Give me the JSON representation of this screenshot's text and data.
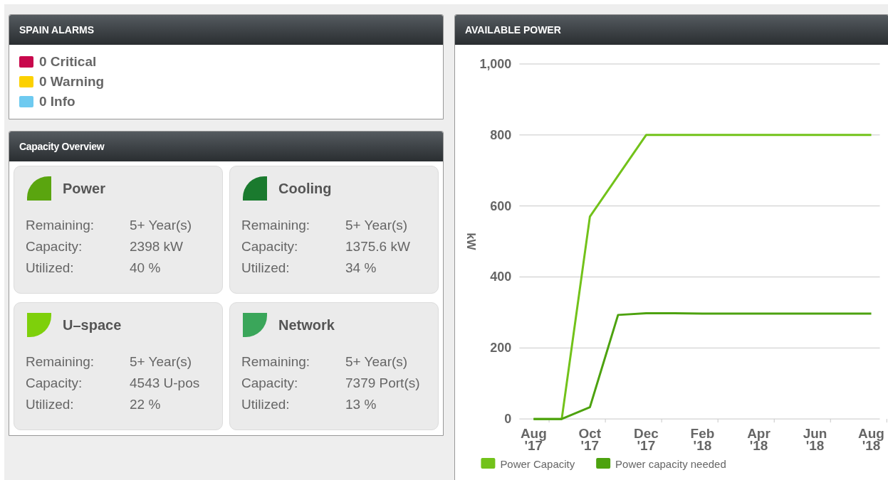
{
  "alarms": {
    "title": "SPAIN ALARMS",
    "items": [
      {
        "label": "0 Critical",
        "color": "#c8084c"
      },
      {
        "label": "0 Warning",
        "color": "#fcd100"
      },
      {
        "label": "0 Info",
        "color": "#6ecaf0"
      }
    ]
  },
  "capacity": {
    "title": "Capacity Overview",
    "cards": [
      {
        "name": "Power",
        "color": "#5aa50f",
        "rows": [
          {
            "label": "Remaining:",
            "value": "5+ Year(s)"
          },
          {
            "label": "Capacity:",
            "value": "2398 kW"
          },
          {
            "label": "Utilized:",
            "value": "40 %"
          }
        ]
      },
      {
        "name": "Cooling",
        "color": "#1a7a2e",
        "rows": [
          {
            "label": "Remaining:",
            "value": "5+ Year(s)"
          },
          {
            "label": "Capacity:",
            "value": "1375.6 kW"
          },
          {
            "label": "Utilized:",
            "value": "34 %"
          }
        ]
      },
      {
        "name": "U–space",
        "color": "#7ed00b",
        "rows": [
          {
            "label": "Remaining:",
            "value": "5+ Year(s)"
          },
          {
            "label": "Capacity:",
            "value": "4543 U-pos"
          },
          {
            "label": "Utilized:",
            "value": "22 %"
          }
        ]
      },
      {
        "name": "Network",
        "color": "#3aa65a",
        "rows": [
          {
            "label": "Remaining:",
            "value": "5+ Year(s)"
          },
          {
            "label": "Capacity:",
            "value": "7379 Port(s)"
          },
          {
            "label": "Utilized:",
            "value": "13 %"
          }
        ]
      }
    ]
  },
  "power": {
    "title": "AVAILABLE POWER",
    "chart_data": {
      "type": "line",
      "ylabel": "kW",
      "grid": true,
      "legend": true,
      "categories": [
        "Aug '17",
        null,
        "Oct '17",
        null,
        "Dec '17",
        null,
        "Feb '18",
        null,
        "Apr '18",
        null,
        "Jun '18",
        null,
        "Aug '18"
      ],
      "series": [
        {
          "name": "Power Capacity",
          "color": "#72c21a",
          "values": [
            0,
            0,
            570,
            685,
            800,
            800,
            800,
            800,
            800,
            800,
            800,
            800,
            800
          ]
        },
        {
          "name": "Power capacity needed",
          "color": "#4da20f",
          "values": [
            0,
            0,
            33,
            293,
            298,
            298,
            297,
            297,
            297,
            297,
            297,
            297,
            297
          ]
        }
      ],
      "ylim": [
        0,
        1000
      ],
      "yticks": [
        {
          "value": 0,
          "label": "0"
        },
        {
          "value": 200,
          "label": "200"
        },
        {
          "value": 400,
          "label": "400"
        },
        {
          "value": 600,
          "label": "600"
        },
        {
          "value": 800,
          "label": "800"
        },
        {
          "value": 1000,
          "label": "1,000"
        }
      ]
    }
  }
}
